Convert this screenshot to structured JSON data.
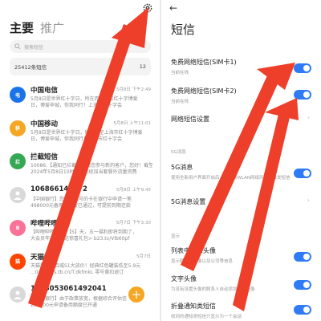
{
  "left": {
    "tabs": [
      "主要",
      "推广"
    ],
    "search_placeholder": "搜索短信",
    "count_text": "25412条短信",
    "count_right": "12",
    "messages": [
      {
        "name": "中国电信",
        "time": "5月8日 下午2:49",
        "line1": "5月8日是世界红十字日，所在而至用以红十字博爱",
        "line2": "日，博爱申城，你我同行！上海市红十字会",
        "avatar_color": "#1a73e8",
        "avatar_text": "电"
      },
      {
        "name": "中国移动",
        "time": "5月8日 上午11:01",
        "line1": "5月8日是世界红十字日，所在而至上海市红十字博爱",
        "line2": "日，博爱申城，你我同行！上海市红十字会",
        "avatar_color": "#f5a623",
        "avatar_text": "移"
      },
      {
        "name": "拦截短信",
        "time": "",
        "line1": "10086:【通知已拦截】邀请您参与新的客户，您好！截至",
        "line2": "2024年5月8日10时，您已经加当套餐外流量资费",
        "avatar_color": "#34a853",
        "avatar_text": "拦"
      },
      {
        "name": "106866146772",
        "time": "5月8日 上午9:45",
        "line1": "【中国银行】您名下尾号的卡在银行中申请一笔",
        "line2": "498000元备用金额度已通过，可提前到期还款",
        "avatar_color": "#d9d9d9",
        "avatar_text": ""
      },
      {
        "name": "哔哩哔哩",
        "time": "5月7日 下午3:30",
        "line1": "【哔哩哔哩哔哩】【5】天，五一福利即将到期了，",
        "line2": "大会员年卡，再送惊喜礼包> b23.tv/Vlb60pf",
        "avatar_color": "#fb7299",
        "avatar_text": "B"
      },
      {
        "name": "天猫超市",
        "time": "5月7日",
        "line1": "天猫超市】百威S1大放价！经典红色罐装低至5.9元",
        "line2": "...0.8元！ s.tb.cn/T.dkfmkL 零号黄扣退订",
        "avatar_color": "#ff4400",
        "avatar_text": "猫"
      },
      {
        "name": "1065053061492041",
        "time": "",
        "line1": "【中国银行】由于政策放宽，根据综合评估信",
        "line2": "298000元申请备用额度已开通",
        "avatar_color": "#d9d9d9",
        "avatar_text": ""
      }
    ]
  },
  "right": {
    "title": "短信",
    "rows": [
      {
        "title": "免费网络短信(SIM卡1)",
        "sub": "当前在线",
        "control": "toggle"
      },
      {
        "title": "免费网络短信(SIM卡2)",
        "sub": "当前在线",
        "control": "toggle"
      },
      {
        "title": "网络短信设置",
        "sub": "",
        "control": "chevron"
      },
      {
        "title": "5G消息",
        "sub": "使用全新用户界面开启后，在移动WLAN网络环境下收发短信",
        "control": "toggle"
      },
      {
        "title": "5G消息设置",
        "sub": "",
        "control": "chevron"
      },
      {
        "title": "列表中显示头像",
        "sub": "显示联系人头像以及公司等信息",
        "control": "toggle"
      },
      {
        "title": "文字头像",
        "sub": "为没有设置头像的联系人自动添加文字头像",
        "control": "toggle"
      },
      {
        "title": "折叠通知类短信",
        "sub": "收到的通知类短信只显示为一个会话",
        "control": "toggle"
      }
    ],
    "section_5g": "5G消息",
    "section_display": "显示"
  },
  "colors": {
    "accent": "#2f7bf5",
    "arrow": "#ee3f2a",
    "fab": "#f5a623"
  }
}
